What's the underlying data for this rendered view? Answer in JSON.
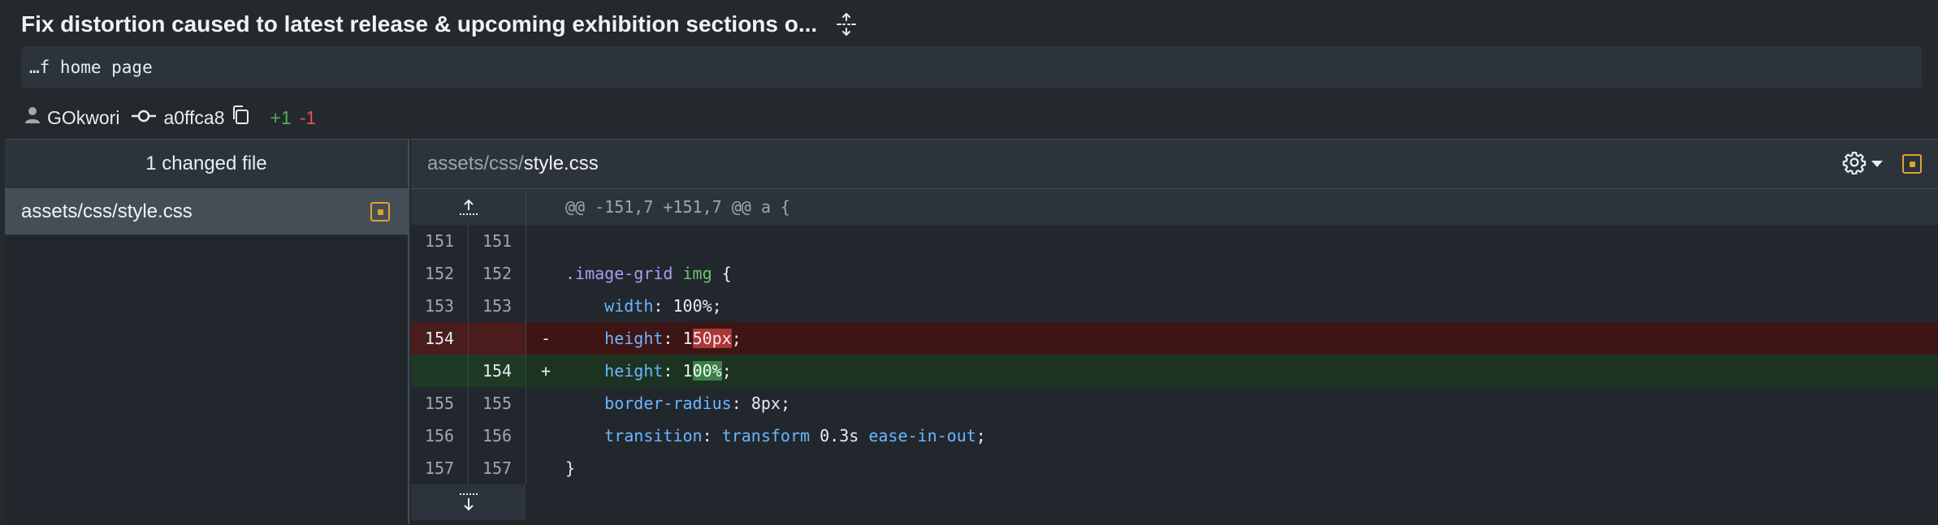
{
  "commit": {
    "title": "Fix distortion caused to latest release & upcoming exhibition sections o...",
    "description": "…f home page",
    "author": "GOkwori",
    "sha": "a0ffca8",
    "additions": "+1",
    "deletions": "-1"
  },
  "files_panel": {
    "heading": "1 changed file",
    "files": [
      {
        "name": "assets/css/style.css",
        "status": "modified"
      }
    ]
  },
  "diff": {
    "path_dir": "assets/css/",
    "path_file": "style.css",
    "hunk_header": "@@ -151,7 +151,7 @@ a {",
    "lines": [
      {
        "type": "context",
        "old": "151",
        "new": "151",
        "sign": "",
        "code": ""
      },
      {
        "type": "context",
        "old": "152",
        "new": "152",
        "sign": "",
        "code": ".image-grid img {"
      },
      {
        "type": "context",
        "old": "153",
        "new": "153",
        "sign": "",
        "code": "width: 100%;"
      },
      {
        "type": "deletion",
        "old": "154",
        "new": "",
        "sign": "-",
        "code": "height: 150px;"
      },
      {
        "type": "addition",
        "old": "",
        "new": "154",
        "sign": "+",
        "code": "height: 100%;"
      },
      {
        "type": "context",
        "old": "155",
        "new": "155",
        "sign": "",
        "code": "border-radius: 8px;"
      },
      {
        "type": "context",
        "old": "156",
        "new": "156",
        "sign": "",
        "code": "transition: transform 0.3s ease-in-out;"
      },
      {
        "type": "context",
        "old": "157",
        "new": "157",
        "sign": "",
        "code": "}"
      }
    ]
  },
  "colors": {
    "background": "#24292e",
    "added": "#57ab5a",
    "deleted": "#e5534b",
    "modified_marker": "#e0a32e"
  },
  "icons": [
    "expand-arrows-icon",
    "user-icon",
    "commit-icon",
    "copy-icon",
    "gear-icon",
    "file-modified-icon",
    "expand-up-icon",
    "expand-down-icon"
  ]
}
